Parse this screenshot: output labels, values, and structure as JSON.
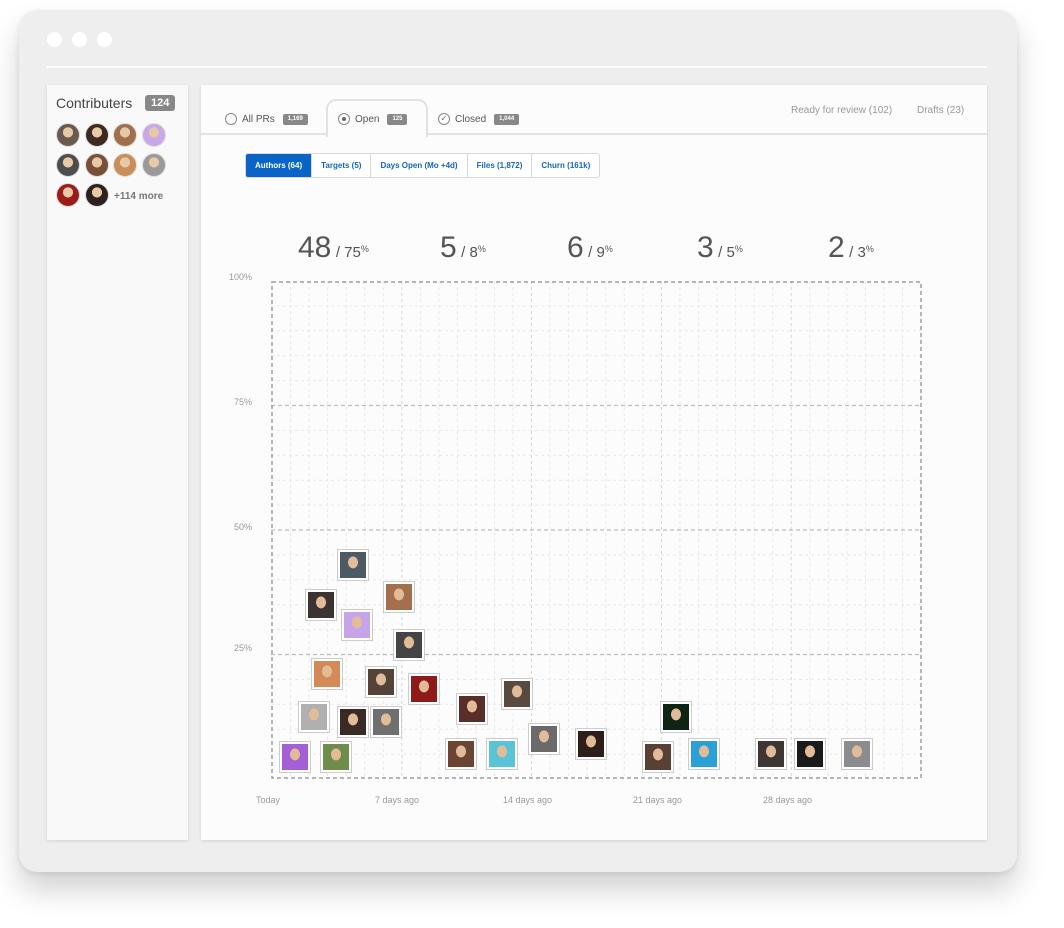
{
  "window": {
    "dots": 3
  },
  "sidebar": {
    "title": "Contributers",
    "count": "124",
    "more": "+114 more",
    "avatars": [
      {
        "name": "avatar-1",
        "color": "#6b5a4e"
      },
      {
        "name": "avatar-2",
        "color": "#3d2a22"
      },
      {
        "name": "avatar-3",
        "color": "#a0704d"
      },
      {
        "name": "avatar-4",
        "color": "#c9a8e8"
      },
      {
        "name": "avatar-5",
        "color": "#4d4d4d"
      },
      {
        "name": "avatar-6",
        "color": "#7a4f3a"
      },
      {
        "name": "avatar-7",
        "color": "#c98e5a"
      },
      {
        "name": "avatar-8",
        "color": "#9a9a9a"
      },
      {
        "name": "avatar-9",
        "color": "#9e1b1b"
      },
      {
        "name": "avatar-10",
        "color": "#2e2220"
      }
    ]
  },
  "tabs": {
    "all": {
      "label": "All PRs",
      "badge": "1,169"
    },
    "open": {
      "label": "Open",
      "badge": "125"
    },
    "closed": {
      "label": "Closed",
      "badge": "1,044"
    },
    "ready": "Ready for review (102)",
    "drafts": "Drafts (23)"
  },
  "segments": [
    {
      "label": "Authors (64)",
      "active": true
    },
    {
      "label": "Targets (5)",
      "active": false
    },
    {
      "label": "Days Open (Mo +4d)",
      "active": false
    },
    {
      "label": "Files (1,872)",
      "active": false
    },
    {
      "label": "Churn (161k)",
      "active": false
    }
  ],
  "stats": [
    {
      "count": "48",
      "pct": "/ 75",
      "unit": "%"
    },
    {
      "count": "5",
      "pct": "/ 8",
      "unit": "%"
    },
    {
      "count": "6",
      "pct": "/ 9",
      "unit": "%"
    },
    {
      "count": "3",
      "pct": "/ 5",
      "unit": "%"
    },
    {
      "count": "2",
      "pct": "/ 3",
      "unit": "%"
    }
  ],
  "chart_data": {
    "type": "scatter",
    "ylabels": [
      "100%",
      "75%",
      "50%",
      "25%"
    ],
    "xlabels": [
      "Today",
      "7 days ago",
      "14 days ago",
      "21 days ago",
      "28 days ago"
    ],
    "ylim": [
      0,
      100
    ],
    "xlim": [
      0,
      35
    ],
    "grid": true,
    "points": [
      {
        "x": 1.3,
        "y": 4.5,
        "color": "#a45fd6"
      },
      {
        "x": 3.5,
        "y": 4.5,
        "color": "#6e8c4a"
      },
      {
        "x": 2.3,
        "y": 12.5,
        "color": "#b0b0b0"
      },
      {
        "x": 4.4,
        "y": 11.5,
        "color": "#3a2a26"
      },
      {
        "x": 6.2,
        "y": 11.5,
        "color": "#6f6f6f"
      },
      {
        "x": 3.0,
        "y": 21,
        "color": "#d48a56"
      },
      {
        "x": 5.9,
        "y": 19.5,
        "color": "#564338"
      },
      {
        "x": 8.2,
        "y": 18,
        "color": "#8e1a1a"
      },
      {
        "x": 7.4,
        "y": 27,
        "color": "#444444"
      },
      {
        "x": 4.6,
        "y": 31,
        "color": "#c6a4ea"
      },
      {
        "x": 2.7,
        "y": 35,
        "color": "#3b3432"
      },
      {
        "x": 6.9,
        "y": 36.5,
        "color": "#a36f4c"
      },
      {
        "x": 4.4,
        "y": 43,
        "color": "#4c5a66"
      },
      {
        "x": 10.8,
        "y": 14,
        "color": "#5a2e28"
      },
      {
        "x": 13.2,
        "y": 17,
        "color": "#594a40"
      },
      {
        "x": 10.2,
        "y": 5,
        "color": "#6b4434"
      },
      {
        "x": 12.4,
        "y": 5,
        "color": "#59c4d8"
      },
      {
        "x": 14.7,
        "y": 8,
        "color": "#6a6a6a"
      },
      {
        "x": 17.2,
        "y": 7,
        "color": "#2e1e1a"
      },
      {
        "x": 20.8,
        "y": 4.5,
        "color": "#5a4034"
      },
      {
        "x": 21.8,
        "y": 12.5,
        "color": "#0f2414"
      },
      {
        "x": 23.3,
        "y": 5,
        "color": "#2aa0d6"
      },
      {
        "x": 26.9,
        "y": 5,
        "color": "#3c3734"
      },
      {
        "x": 29.0,
        "y": 5,
        "color": "#1a1a1a"
      },
      {
        "x": 31.5,
        "y": 5,
        "color": "#8a8c90"
      }
    ]
  }
}
